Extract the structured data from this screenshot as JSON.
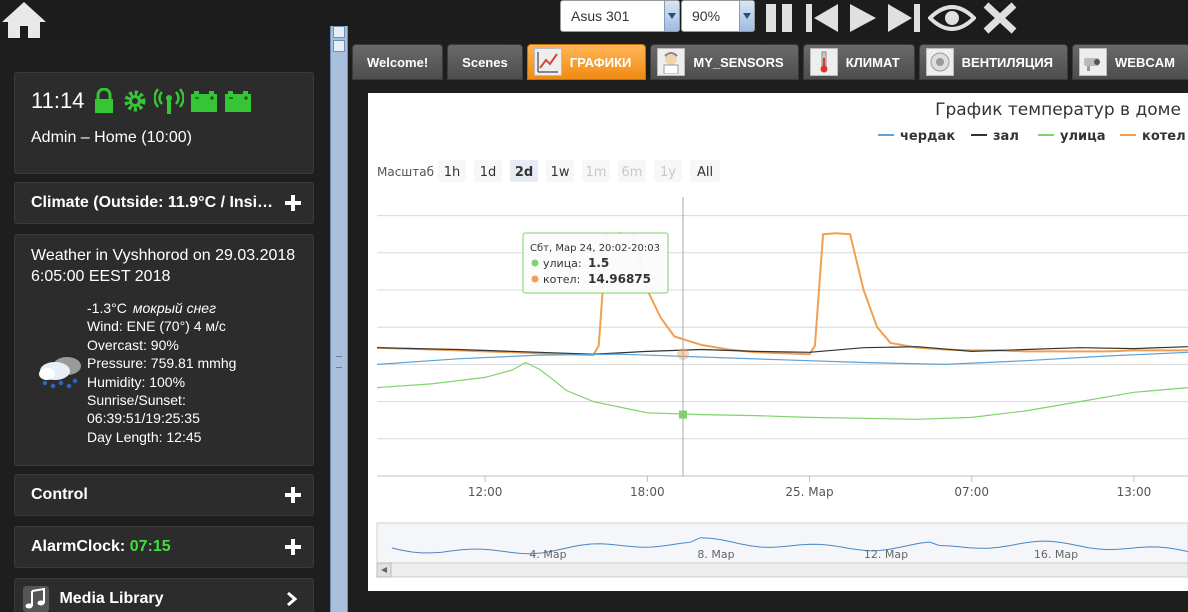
{
  "topbar": {
    "device_select": "Asus 301",
    "zoom_select": "90%",
    "player_icons": [
      "pause-icon",
      "previous-icon",
      "play-icon",
      "next-icon",
      "eye-icon",
      "close-icon"
    ]
  },
  "status": {
    "time": "11:14",
    "icons": [
      "lock-icon",
      "gear-icon",
      "wireless-icon",
      "battery-icon",
      "battery-icon"
    ],
    "user_line": "Admin – Home (10:00)"
  },
  "panels": {
    "climate": "Climate (Outside: 11.9°C / Insi…",
    "weather": {
      "title": "Weather in Vyshhorod on 29.03.2018 6:05:00 EEST 2018",
      "temperature": "-1.3°C",
      "condition": "мокрый снег",
      "lines": [
        "Wind: ENE (70°) 4 м/с",
        "Overcast: 90%",
        "Pressure: 759.81 mmhg",
        "Humidity: 100%",
        "Sunrise/Sunset:",
        "06:39:51/19:25:35",
        "Day Length: 12:45"
      ]
    },
    "control": "Control",
    "alarm_label": "AlarmClock:",
    "alarm_time": "07:15",
    "media": "Media Library"
  },
  "tabs": [
    {
      "label": "Welcome!",
      "active": false
    },
    {
      "label": "Scenes",
      "active": false
    },
    {
      "label": "ГРАФИКИ",
      "active": true
    },
    {
      "label": "MY_SENSORS",
      "active": false
    },
    {
      "label": "КЛИМАТ",
      "active": false
    },
    {
      "label": "ВЕНТИЛЯЦИЯ",
      "active": false
    },
    {
      "label": "WEBCAM",
      "active": false
    }
  ],
  "colors": {
    "accent": "#f08b12",
    "series_cherdak": "#5ba3d9",
    "series_zal": "#333333",
    "series_ulica": "#7ed36b",
    "series_kotel": "#f0a050"
  },
  "chart_data": {
    "type": "line",
    "title": "График температур в доме",
    "legend": [
      "чердак",
      "зал",
      "улица",
      "котел"
    ],
    "legend_position": "top-right",
    "range_label": "Масштаб",
    "range_buttons": [
      "1h",
      "1d",
      "2d",
      "1w",
      "1m",
      "6m",
      "1y",
      "All"
    ],
    "range_selected": "2d",
    "x_ticks": [
      "12:00",
      "18:00",
      "25. Мар",
      "07:00",
      "13:00"
    ],
    "navigator_ticks": [
      "4. Мар",
      "8. Мар",
      "12. Мар",
      "16. Мар"
    ],
    "tooltip": {
      "header": "Сбт, Мар 24, 20:02-20:03",
      "rows": [
        {
          "name": "улица",
          "value": "1.5"
        },
        {
          "name": "котел",
          "value": "14.96875"
        }
      ]
    },
    "grid": true,
    "series": [
      {
        "name": "котел",
        "x_hours": [
          0,
          1,
          2,
          3,
          4,
          5,
          6,
          7,
          8,
          8.2,
          8.5,
          9,
          9.5,
          10,
          10.5,
          11,
          12,
          13,
          14,
          15,
          16,
          16.2,
          16.5,
          17,
          17.5,
          18,
          18.5,
          19,
          20,
          21,
          22,
          23,
          24,
          25,
          26,
          27,
          28,
          29,
          30
        ],
        "y": [
          15.8,
          15.7,
          15.6,
          15.5,
          15.4,
          15.3,
          15.2,
          15.1,
          15.0,
          16,
          28,
          28.1,
          28,
          22,
          19,
          17,
          16.1,
          15.6,
          15.3,
          15.2,
          15.1,
          16,
          28,
          28.1,
          28,
          22,
          18,
          16.3,
          15.8,
          15.6,
          15.5,
          15.5,
          15.4,
          15.4,
          15.4,
          15.4,
          15.5,
          15.5,
          15.5
        ]
      },
      {
        "name": "зал",
        "x_hours": [
          0,
          3,
          6,
          8,
          10,
          12,
          14,
          16,
          18,
          20,
          22,
          24,
          26,
          28,
          30
        ],
        "y": [
          15.8,
          15.6,
          15.3,
          15.1,
          15.4,
          15.6,
          15.4,
          15.3,
          15.8,
          15.9,
          15.4,
          15.6,
          15.8,
          15.7,
          15.9
        ]
      },
      {
        "name": "чердак",
        "x_hours": [
          0,
          3,
          6,
          9,
          12,
          15,
          18,
          21,
          24,
          27,
          30
        ],
        "y": [
          14.0,
          14.6,
          15.0,
          15.1,
          14.8,
          14.5,
          14.2,
          14.0,
          14.4,
          14.9,
          15.3
        ]
      },
      {
        "name": "улица",
        "x_hours": [
          0,
          2,
          4,
          5,
          5.5,
          6,
          6.5,
          7,
          8,
          10,
          12,
          14,
          16,
          18,
          20,
          22,
          24,
          26,
          28,
          30
        ],
        "y": [
          11.5,
          11.9,
          12.6,
          13.4,
          14.2,
          13.5,
          12.4,
          11.2,
          10.0,
          8.8,
          8.6,
          8.5,
          8.3,
          8.2,
          8.1,
          8.3,
          9.0,
          10.0,
          11.0,
          11.5
        ]
      }
    ]
  }
}
